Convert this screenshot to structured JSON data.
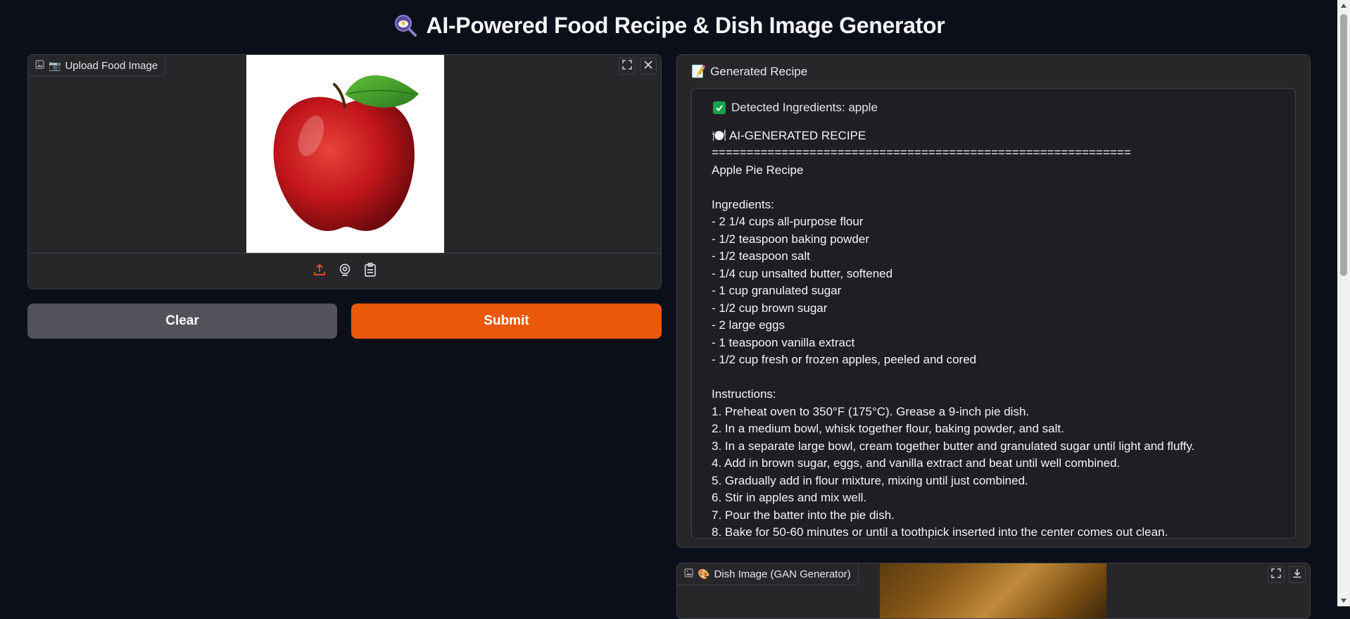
{
  "app": {
    "title": "AI-Powered Food Recipe & Dish Image Generator",
    "title_icon": "magnifier-food-icon"
  },
  "upload": {
    "label": "Upload Food Image",
    "label_icon": "camera-emoji",
    "image_alt": "red apple"
  },
  "buttons": {
    "clear": "Clear",
    "submit": "Submit"
  },
  "recipe": {
    "label": "Generated Recipe",
    "label_icon": "memo-emoji",
    "detected": "Detected Ingredients: apple",
    "body": "🍽️ AI-GENERATED RECIPE\n============================================================\nApple Pie Recipe\n\nIngredients:\n- 2 1/4 cups all-purpose flour\n- 1/2 teaspoon baking powder\n- 1/2 teaspoon salt\n- 1/4 cup unsalted butter, softened\n- 1 cup granulated sugar\n- 1/2 cup brown sugar\n- 2 large eggs\n- 1 teaspoon vanilla extract\n- 1/2 cup fresh or frozen apples, peeled and cored\n\nInstructions:\n1. Preheat oven to 350°F (175°C). Grease a 9-inch pie dish.\n2. In a medium bowl, whisk together flour, baking powder, and salt.\n3. In a separate large bowl, cream together butter and granulated sugar until light and fluffy.\n4. Add in brown sugar, eggs, and vanilla extract and beat until well combined.\n5. Gradually add in flour mixture, mixing until just combined.\n6. Stir in apples and mix well.\n7. Pour the batter into the pie dish.\n8. Bake for 50-60 minutes or until a toothpick inserted into the center comes out clean."
  },
  "dish": {
    "label": "Dish Image (GAN Generator)",
    "label_icon": "palette-emoji"
  },
  "colors": {
    "accent": "#ea580c",
    "background": "#0b0f19",
    "panel": "#27272a",
    "clear_button": "#52525b"
  }
}
